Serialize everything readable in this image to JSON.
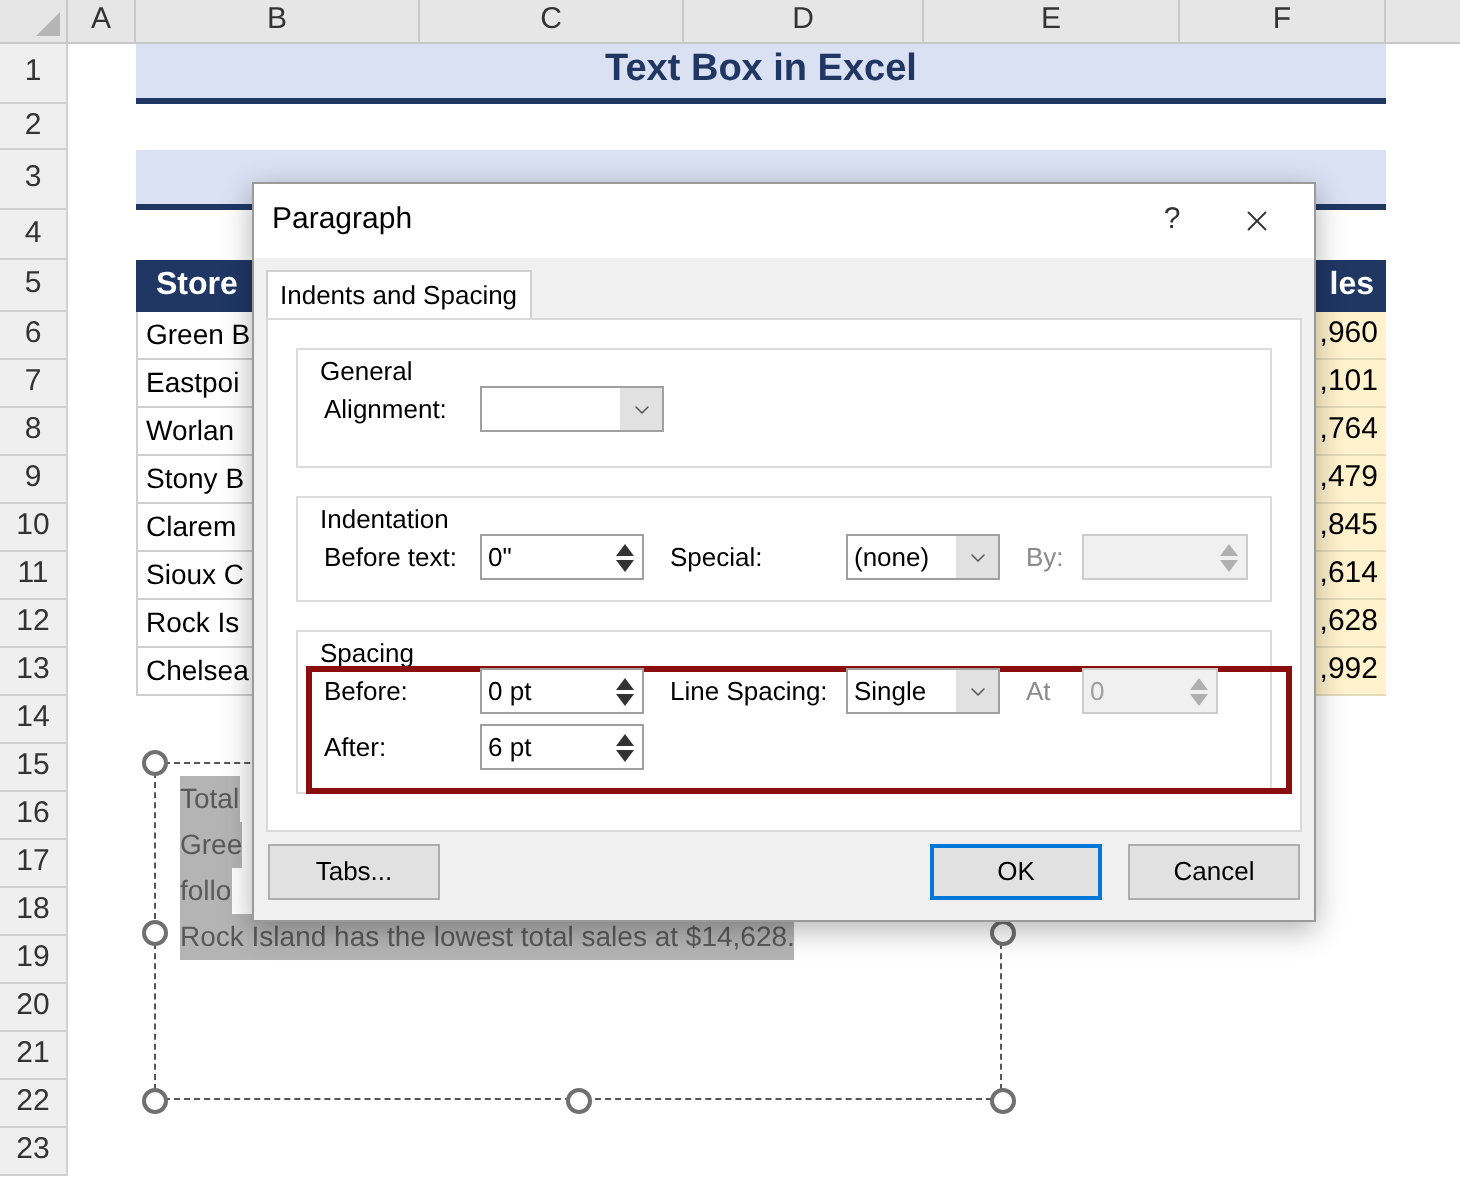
{
  "sheet": {
    "columns": [
      "A",
      "B",
      "C",
      "D",
      "E",
      "F"
    ],
    "rows": [
      "1",
      "2",
      "3",
      "4",
      "5",
      "6",
      "7",
      "8",
      "9",
      "10",
      "11",
      "12",
      "13",
      "14",
      "15",
      "16",
      "17",
      "18",
      "19",
      "20",
      "21",
      "22",
      "23"
    ],
    "title": "Text Box in Excel",
    "subtitle_band": true,
    "table": {
      "headers": [
        "Store",
        "les"
      ],
      "rows": [
        [
          "Green B",
          ",960"
        ],
        [
          "Eastpoi",
          ",101"
        ],
        [
          "Worlan",
          ",764"
        ],
        [
          "Stony B",
          ",479"
        ],
        [
          "Clarem",
          ",845"
        ],
        [
          "Sioux C",
          ",614"
        ],
        [
          "Rock Is",
          ",628"
        ],
        [
          "Chelsea",
          ",992"
        ]
      ]
    }
  },
  "text_box": {
    "lines": [
      "Total",
      "Gree",
      "follo",
      "Rock Island has the lowest total sales at $14,628."
    ]
  },
  "dialog": {
    "title": "Paragraph",
    "help": "?",
    "tabs": [
      {
        "label": "Indents and Spacing",
        "selected": true
      }
    ],
    "groups": [
      {
        "title": "General",
        "highlighted": false,
        "rows": [
          [
            {
              "kind": "dropdown",
              "label": "Alignment:",
              "disabled": false
            }
          ]
        ]
      },
      {
        "title": "Indentation",
        "highlighted": false,
        "rows": [
          [
            {
              "kind": "spinner",
              "label": "Before text:",
              "value": "0\"",
              "disabled": false
            },
            {
              "kind": "dropdown",
              "label": "Special:",
              "value": "(none)",
              "disabled": false
            },
            {
              "kind": "spinner",
              "label": "By:",
              "disabled": true
            }
          ]
        ]
      },
      {
        "title": "Spacing",
        "highlighted": true,
        "rows": [
          [
            {
              "kind": "spinner",
              "label": "Before:",
              "value": "0 pt",
              "disabled": false
            },
            {
              "kind": "dropdown",
              "label": "Line Spacing:",
              "value": "Single",
              "disabled": false
            },
            {
              "kind": "spinner",
              "label": "At",
              "value": "0",
              "disabled": true
            }
          ],
          [
            {
              "kind": "spinner",
              "label": "After:",
              "value": "6 pt",
              "disabled": false
            }
          ]
        ]
      }
    ],
    "buttons": [
      {
        "label": "Tabs...",
        "default": false
      },
      {
        "label": "OK",
        "default": true
      },
      {
        "label": "Cancel",
        "default": false
      }
    ]
  }
}
